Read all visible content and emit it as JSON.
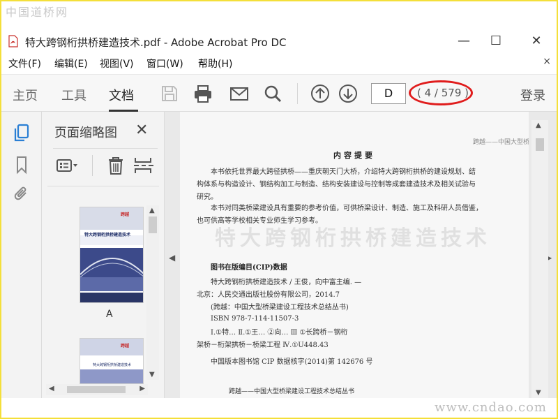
{
  "watermarks": {
    "top": "中国道桥网",
    "bottom": "www.cndao.com"
  },
  "window": {
    "title": "特大跨钢桁拱桥建造技术.pdf - Adobe Acrobat Pro DC",
    "minimize": "—",
    "maximize": "☐",
    "close": "✕"
  },
  "menu": {
    "items": [
      "文件(F)",
      "编辑(E)",
      "视图(V)",
      "窗口(W)",
      "帮助(H)"
    ],
    "close": "×"
  },
  "toolbar": {
    "tabs": [
      "主页",
      "工具",
      "文档"
    ],
    "active_tab": "文档",
    "page_input": "D",
    "page_count": "( 4 / 579 )",
    "login": "登录"
  },
  "thumbnail_panel": {
    "title": "页面缩略图",
    "close": "✕",
    "thumbnails": [
      {
        "label": "A",
        "cover_title": "特大跨钢桁拱桥建造技术"
      },
      {
        "label": "",
        "cover_title": "特大跨钢桁拱桥建造技术"
      }
    ]
  },
  "document": {
    "header": "跨越——中国大型桥梁建设工程技术总结丛书",
    "section_title": "内容提要",
    "para1": [
      "本书依托世界最大跨径拱桥——重庆朝天门大桥，介绍特大跨钢桁拱桥的建设规划、结",
      "构体系与构造设计、钢结构加工与制造、结构安装建设与控制等成套建造技术及相关试验与",
      "研究。"
    ],
    "para2": [
      "本书对同类桥梁建设具有重要的参考价值，可供桥梁设计、制造、施工及科研人员借鉴，",
      "也可供高等学校相关专业师生学习参考。"
    ],
    "ghost_title": "特大跨钢桁拱桥建造技术",
    "cip_title": "图书在版编目(CIP)数据",
    "cip_lines": [
      "特大跨钢桁拱桥建造技术 / 王俊，向中富主编. —",
      "北京：人民交通出版社股份有限公司，2014.7",
      "(跨越：中国大型桥梁建设工程技术总结丛书)",
      "ISBN 978-7-114-11507-3",
      "Ⅰ.①特…  Ⅱ.①王…  ②向…   Ⅲ ①长跨桥－钢桁",
      "架桥－桁架拱桥－桥梁工程  Ⅳ.①U448.43",
      "中国版本图书馆 CIP 数据核字(2014)第 142676 号"
    ],
    "footer": "跨越——中国大型桥梁建设工程技术总结丛书"
  },
  "colors": {
    "accent_blue": "#2a7fd4",
    "highlight_red": "#e01c1c",
    "frame_yellow": "#f4df3a"
  }
}
